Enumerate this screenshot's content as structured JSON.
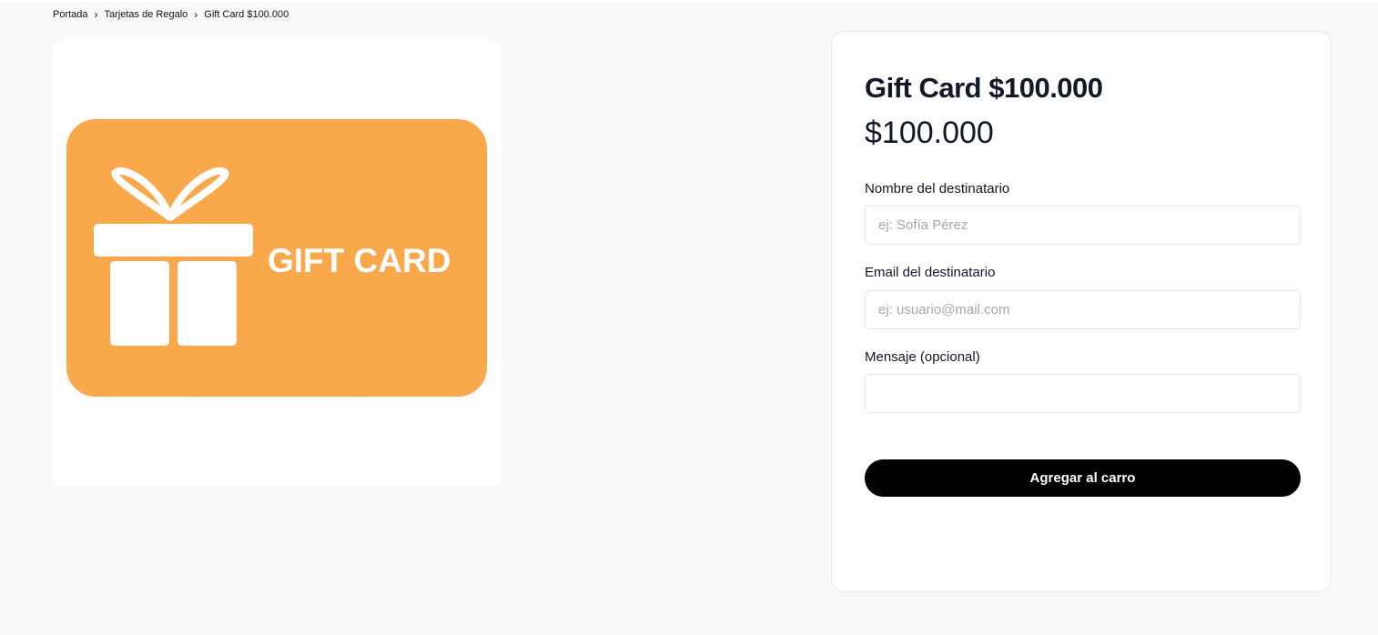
{
  "breadcrumb": {
    "items": [
      "Portada",
      "Tarjetas de Regalo",
      "Gift Card $100.000"
    ],
    "separator": "›"
  },
  "gift_image": {
    "label": "GIFT CARD",
    "card_color": "#f9a94b",
    "icon": "gift-icon"
  },
  "product": {
    "title": "Gift Card $100.000",
    "price": "$100.000"
  },
  "form": {
    "recipient_name": {
      "label": "Nombre del destinatario",
      "placeholder": "ej: Sofía Pérez",
      "value": ""
    },
    "recipient_email": {
      "label": "Email del destinatario",
      "placeholder": "ej: usuario@mail.com",
      "value": ""
    },
    "message": {
      "label": "Mensaje (opcional)",
      "placeholder": "",
      "value": ""
    },
    "submit_label": "Agregar al carro"
  },
  "colors": {
    "page_background": "#f8f9fb",
    "button_background": "#000000",
    "text": "#111827"
  }
}
